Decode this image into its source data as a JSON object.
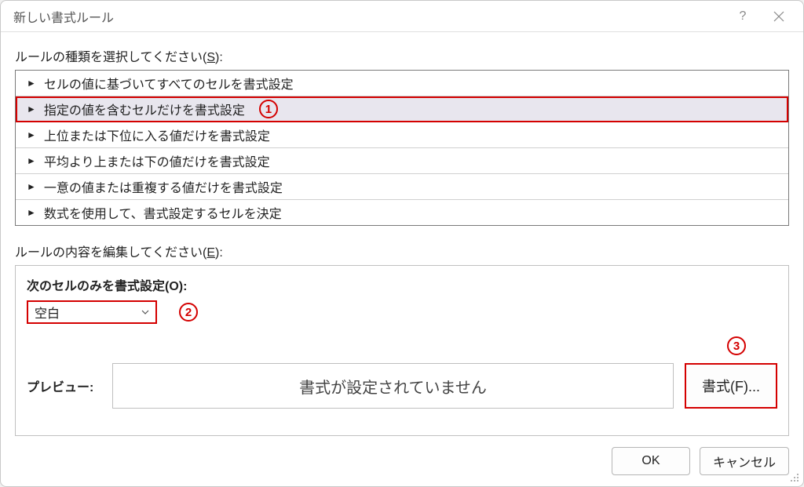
{
  "title": "新しい書式ルール",
  "sections": {
    "rule_type_label_pre": "ルールの種類を選択してください(",
    "rule_type_accel": "S",
    "rule_type_label_post": "):",
    "rule_types": [
      "セルの値に基づいてすべてのセルを書式設定",
      "指定の値を含むセルだけを書式設定",
      "上位または下位に入る値だけを書式設定",
      "平均より上または下の値だけを書式設定",
      "一意の値または重複する値だけを書式設定",
      "数式を使用して、書式設定するセルを決定"
    ],
    "rule_type_selected_index": 1,
    "rule_edit_label_pre": "ルールの内容を編集してください(",
    "rule_edit_accel": "E",
    "rule_edit_label_post": "):",
    "format_only_label": "次のセルのみを書式設定(O):",
    "condition_dropdown_value": "空白",
    "preview_label": "プレビュー:",
    "preview_text": "書式が設定されていません",
    "format_button": "書式(F)...",
    "ok_button": "OK",
    "cancel_button": "キャンセル"
  },
  "annotations": {
    "a1": "1",
    "a2": "2",
    "a3": "3"
  }
}
